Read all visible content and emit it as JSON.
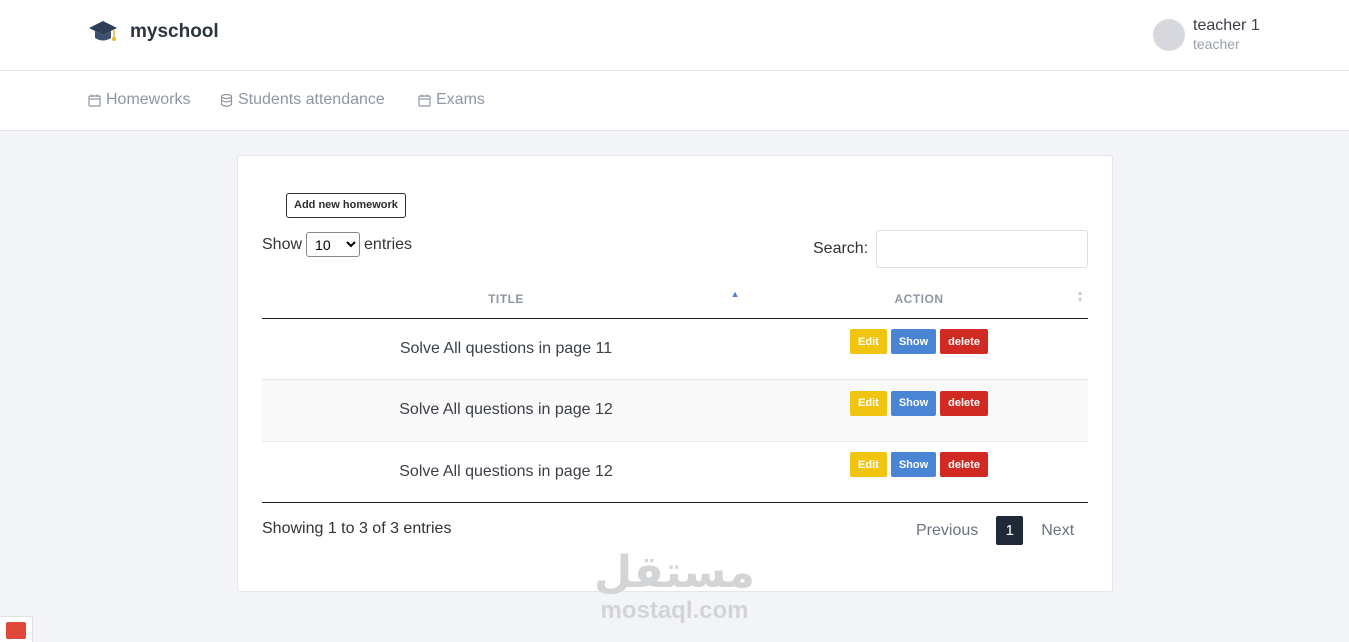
{
  "app": {
    "name": "myschool",
    "logo_icon": "graduation-cap-icon"
  },
  "user": {
    "name": "teacher 1",
    "role": "teacher"
  },
  "nav": [
    {
      "label": "Homeworks",
      "icon": "calendar-icon"
    },
    {
      "label": "Students attendance",
      "icon": "database-icon"
    },
    {
      "label": "Exams",
      "icon": "calendar-icon"
    }
  ],
  "page": {
    "add_button": "Add new homework",
    "length": {
      "prefix": "Show",
      "value": "10",
      "suffix": "entries"
    },
    "search": {
      "label": "Search:",
      "value": ""
    },
    "table": {
      "columns": [
        "TITLE",
        "ACTION"
      ],
      "rows": [
        {
          "title": "Solve All questions in page 11"
        },
        {
          "title": "Solve All questions in page 12"
        },
        {
          "title": "Solve All questions in page 12"
        }
      ],
      "actions": {
        "edit": "Edit",
        "show": "Show",
        "delete": "delete"
      }
    },
    "info": "Showing 1 to 3 of 3 entries",
    "pagination": {
      "previous": "Previous",
      "current": "1",
      "next": "Next"
    }
  },
  "colors": {
    "edit": "#f1c40f",
    "show": "#4a84d4",
    "delete": "#d02a22",
    "current_page": "#1f2937"
  },
  "watermark": {
    "arabic": "مستقل",
    "latin": "mostaql.com"
  }
}
